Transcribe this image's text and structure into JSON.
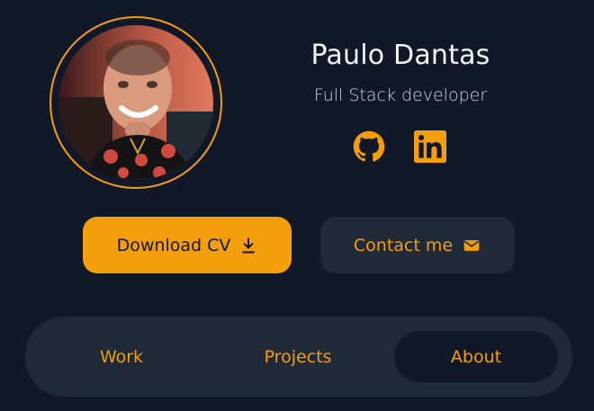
{
  "profile": {
    "name": "Paulo Dantas",
    "role": "Full Stack developer",
    "avatar_alt": "avatar"
  },
  "socials": [
    {
      "name": "github",
      "icon": "github-icon"
    },
    {
      "name": "linkedin",
      "icon": "linkedin-icon"
    }
  ],
  "actions": {
    "download_label": "Download CV",
    "contact_label": "Contact me"
  },
  "tabs": [
    {
      "label": "Work"
    },
    {
      "label": "Projects"
    },
    {
      "label": "About",
      "active": true
    }
  ],
  "colors": {
    "background": "#111827",
    "surface": "#1f2937",
    "accent": "#f59e0b",
    "text": "#f3f4f6",
    "muted": "#cbd5e1"
  }
}
